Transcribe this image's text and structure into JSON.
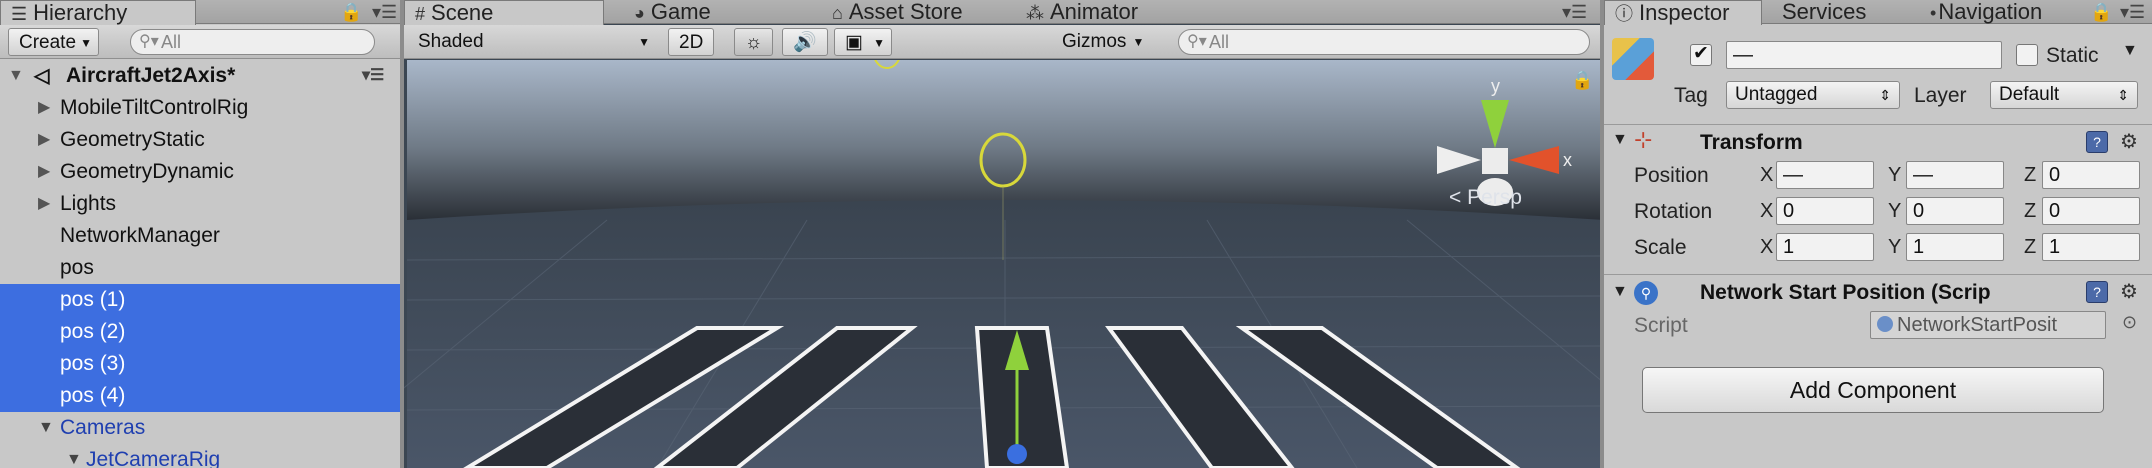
{
  "hierarchy": {
    "tab_label": "Hierarchy",
    "create_label": "Create",
    "search_placeholder": "All",
    "root_label": "AircraftJet2Axis*",
    "items": [
      {
        "label": "MobileTiltControlRig"
      },
      {
        "label": "GeometryStatic"
      },
      {
        "label": "GeometryDynamic"
      },
      {
        "label": "Lights"
      },
      {
        "label": "NetworkManager"
      },
      {
        "label": "pos"
      },
      {
        "label": "pos (1)"
      },
      {
        "label": "pos (2)"
      },
      {
        "label": "pos (3)"
      },
      {
        "label": "pos (4)"
      },
      {
        "label": "Cameras"
      },
      {
        "label": "JetCameraRig"
      }
    ]
  },
  "scene": {
    "tabs": [
      {
        "label": "Scene",
        "icon": "grid-icon"
      },
      {
        "label": "Game",
        "icon": "pacman-icon"
      },
      {
        "label": "Asset Store",
        "icon": "bag-icon"
      },
      {
        "label": "Animator",
        "icon": "animator-icon"
      }
    ],
    "shading_mode": "Shaded",
    "mode_2d_label": "2D",
    "gizmos_label": "Gizmos",
    "search_placeholder": "All",
    "persp_label": "Persp",
    "axis_x_label": "x",
    "axis_y_label": "y",
    "colors": {
      "x_axis": "#e2522b",
      "y_axis": "#8fd13c",
      "z_axis": "#3a6fe0",
      "gizmo_ring": "#d8d83a",
      "selection": "#3d6ee0"
    }
  },
  "inspector": {
    "tabs": [
      {
        "label": "Inspector",
        "icon": "info-icon"
      },
      {
        "label": "Services"
      },
      {
        "label": "Navigation"
      }
    ],
    "object_name": "—",
    "static_label": "Static",
    "tag_label": "Tag",
    "tag_value": "Untagged",
    "layer_label": "Layer",
    "layer_value": "Default",
    "transform": {
      "title": "Transform",
      "rows": [
        {
          "label": "Position",
          "x": "—",
          "y": "—",
          "z": "0"
        },
        {
          "label": "Rotation",
          "x": "0",
          "y": "0",
          "z": "0"
        },
        {
          "label": "Scale",
          "x": "1",
          "y": "1",
          "z": "1"
        }
      ]
    },
    "axis_labels": {
      "x": "X",
      "y": "Y",
      "z": "Z"
    },
    "network_start": {
      "title": "Network Start Position (Scrip",
      "script_label": "Script",
      "script_value": "NetworkStartPosit"
    },
    "add_component_label": "Add Component"
  }
}
